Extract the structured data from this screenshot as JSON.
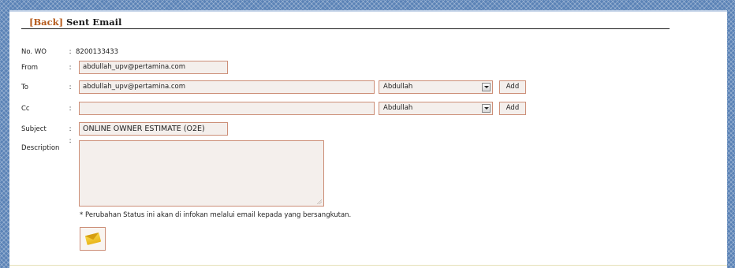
{
  "header": {
    "back_open": "[",
    "back_label": "Back",
    "back_close": "]",
    "title": "Sent Email"
  },
  "form": {
    "colon": ":",
    "no_wo": {
      "label": "No. WO",
      "value": "8200133433"
    },
    "from": {
      "label": "From",
      "value": "abdullah_upv@pertamina.com"
    },
    "to": {
      "label": "To",
      "value": "abdullah_upv@pertamina.com",
      "select_value": "Abdullah",
      "add_label": "Add"
    },
    "cc": {
      "label": "Cc",
      "value": "",
      "select_value": "Abdullah",
      "add_label": "Add"
    },
    "subject": {
      "label": "Subject",
      "value": "ONLINE OWNER ESTIMATE (O2E)"
    },
    "description": {
      "label": "Description",
      "value": ""
    },
    "note": "* Perubahan Status ini akan di infokan melalui email kepada yang bersangkutan.",
    "send_icon": "envelope-icon"
  },
  "colors": {
    "background": "#5a82b6",
    "field_border": "#cc8e77",
    "field_fill": "#f4efec",
    "back_link": "#b55a1b"
  }
}
